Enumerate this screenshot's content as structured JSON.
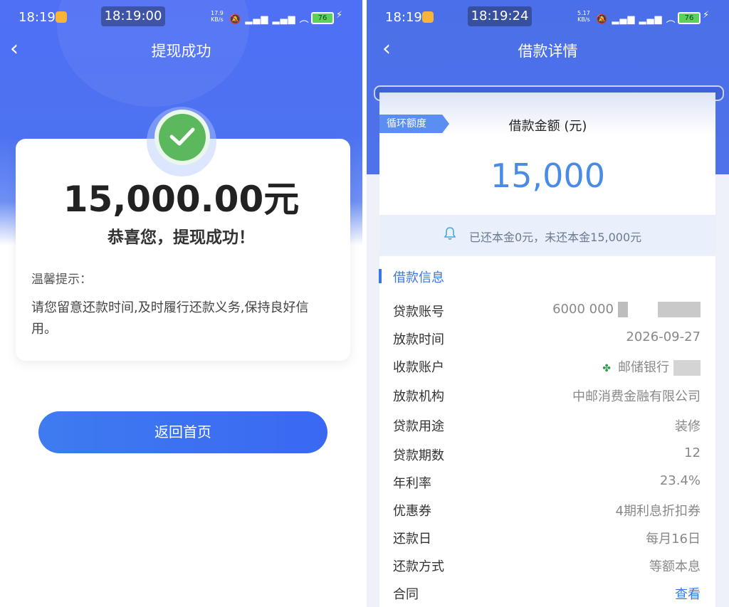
{
  "left": {
    "status": {
      "time": "18:19",
      "clock": "18:19:00",
      "speed": "17.9\nKB/s",
      "battery": "76"
    },
    "nav": {
      "title": "提现成功"
    },
    "amount": "15,000.00元",
    "congrats": "恭喜您，提现成功！",
    "tip_title": "温馨提示：",
    "tip_text": "请您留意还款时间,及时履行还款义务,保持良好信用。",
    "home_button": "返回首页"
  },
  "right": {
    "status": {
      "time": "18:19",
      "clock": "18:19:24",
      "speed": "5.17\nKB/s",
      "battery": "76"
    },
    "nav": {
      "title": "借款详情"
    },
    "tag": "循环额度",
    "loan_label": "借款金额 (元)",
    "loan_value": "15,000",
    "repaid_text": "已还本金0元，未还本金15,000元",
    "section_title": "借款信息",
    "rows": [
      {
        "k": "贷款账号",
        "v": "6000 000"
      },
      {
        "k": "放款时间",
        "v": "2026-09-27"
      },
      {
        "k": "收款账户",
        "v": "邮储银行"
      },
      {
        "k": "放款机构",
        "v": "中邮消费金融有限公司"
      },
      {
        "k": "贷款用途",
        "v": "装修"
      },
      {
        "k": "贷款期数",
        "v": "12"
      },
      {
        "k": "年利率",
        "v": "23.4%"
      },
      {
        "k": "优惠券",
        "v": "4期利息折扣券"
      },
      {
        "k": "还款日",
        "v": "每月16日"
      },
      {
        "k": "还款方式",
        "v": "等额本息"
      },
      {
        "k": "合同",
        "v": "查看"
      }
    ]
  }
}
